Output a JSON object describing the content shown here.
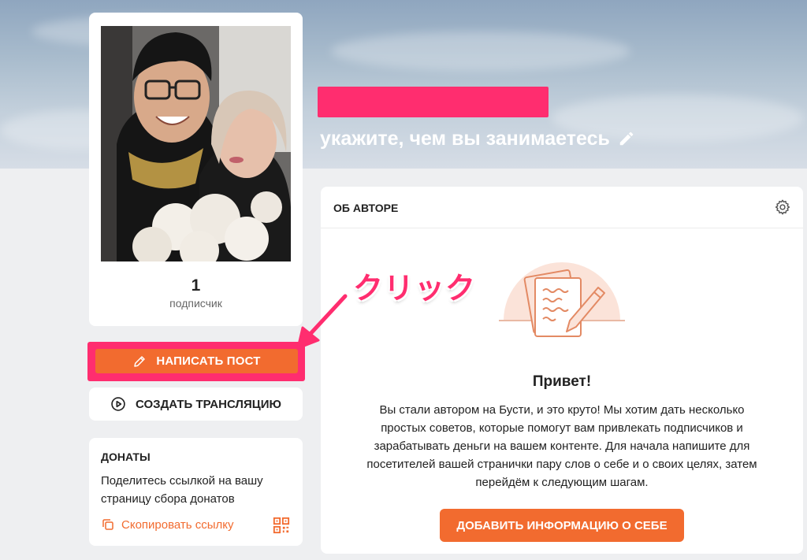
{
  "profile": {
    "tagline": "укажите, чем вы занимаетесь",
    "subscribers_count": "1",
    "subscribers_label": "подписчик"
  },
  "actions": {
    "write_post": "НАПИСАТЬ ПОСТ",
    "create_stream": "СОЗДАТЬ ТРАНСЛЯЦИЮ"
  },
  "donations": {
    "title": "ДОНАТЫ",
    "text": "Поделитесь ссылкой на вашу страницу сбора донатов",
    "copy_link": "Скопировать ссылку"
  },
  "about": {
    "title": "ОБ АВТОРЕ",
    "greeting": "Привет!",
    "text": "Вы стали автором на Бусти, и это круто! Мы хотим дать несколько простых советов, которые помогут вам привлекать подписчиков и зарабатывать деньги на вашем контенте. Для начала напишите для посетителей вашей странички пару слов о себе и о своих целях, затем перейдём к следующим шагам.",
    "add_info_button": "ДОБАВИТЬ ИНФОРМАЦИЮ О СЕБЕ"
  },
  "annotation": {
    "label": "クリック"
  },
  "colors": {
    "accent": "#f26b2f",
    "highlight": "#ff2d6f",
    "background": "#eeeff1"
  }
}
